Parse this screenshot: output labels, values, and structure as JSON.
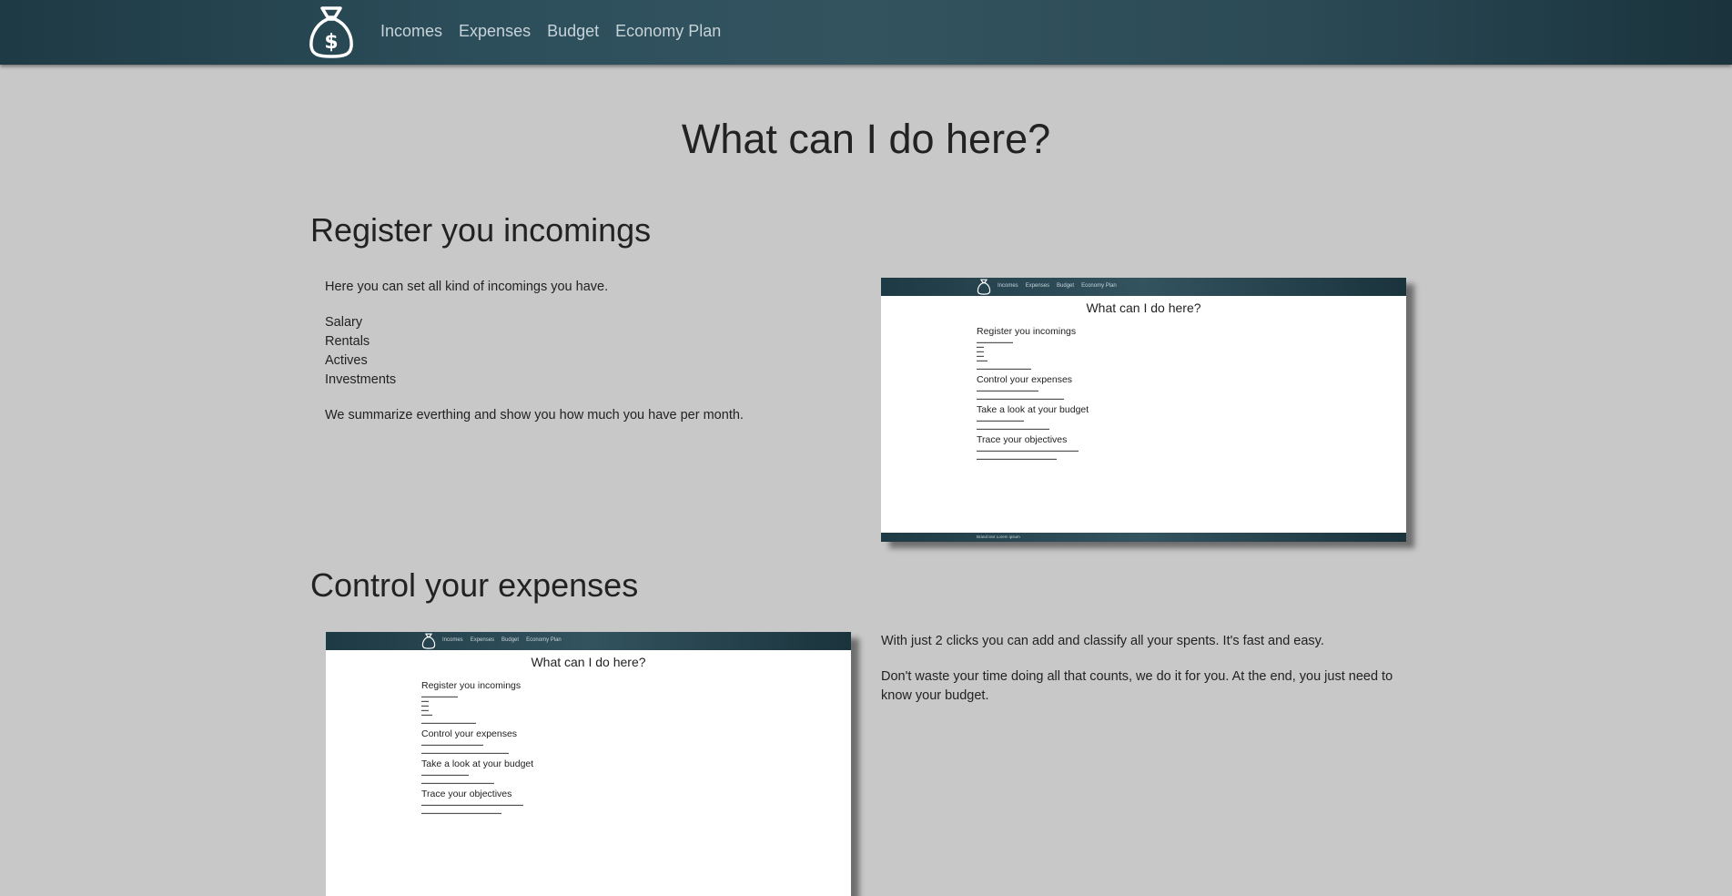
{
  "nav": {
    "logo_icon": "money-bag-icon",
    "links": [
      "Incomes",
      "Expenses",
      "Budget",
      "Economy Plan"
    ]
  },
  "page_title": "What can I do here?",
  "sections": [
    {
      "title": "Register you incomings",
      "intro": "Here you can set all kind of incomings you have.",
      "items": [
        "Salary",
        "Rentals",
        "Actives",
        "Investments"
      ],
      "summary": "We summarize everthing and show you how much you have per month."
    },
    {
      "title": "Control your expenses",
      "para1": "With just 2 clicks you can add and classify all your spents. It's fast and easy.",
      "para2": "Don't waste your time doing all that counts, we do it for you. At the end, you just need to know your budget."
    }
  ],
  "preview": {
    "title": "What can I do here?",
    "headings": [
      "Register you incomings",
      "Control your expenses",
      "Take a look at your budget",
      "Trace your objectives"
    ],
    "footer": "Brand text Lorem ipsum"
  },
  "colors": {
    "background": "#c8c8c8",
    "navbar": "#2d4f5c",
    "nav_link": "#c7d3d8"
  }
}
